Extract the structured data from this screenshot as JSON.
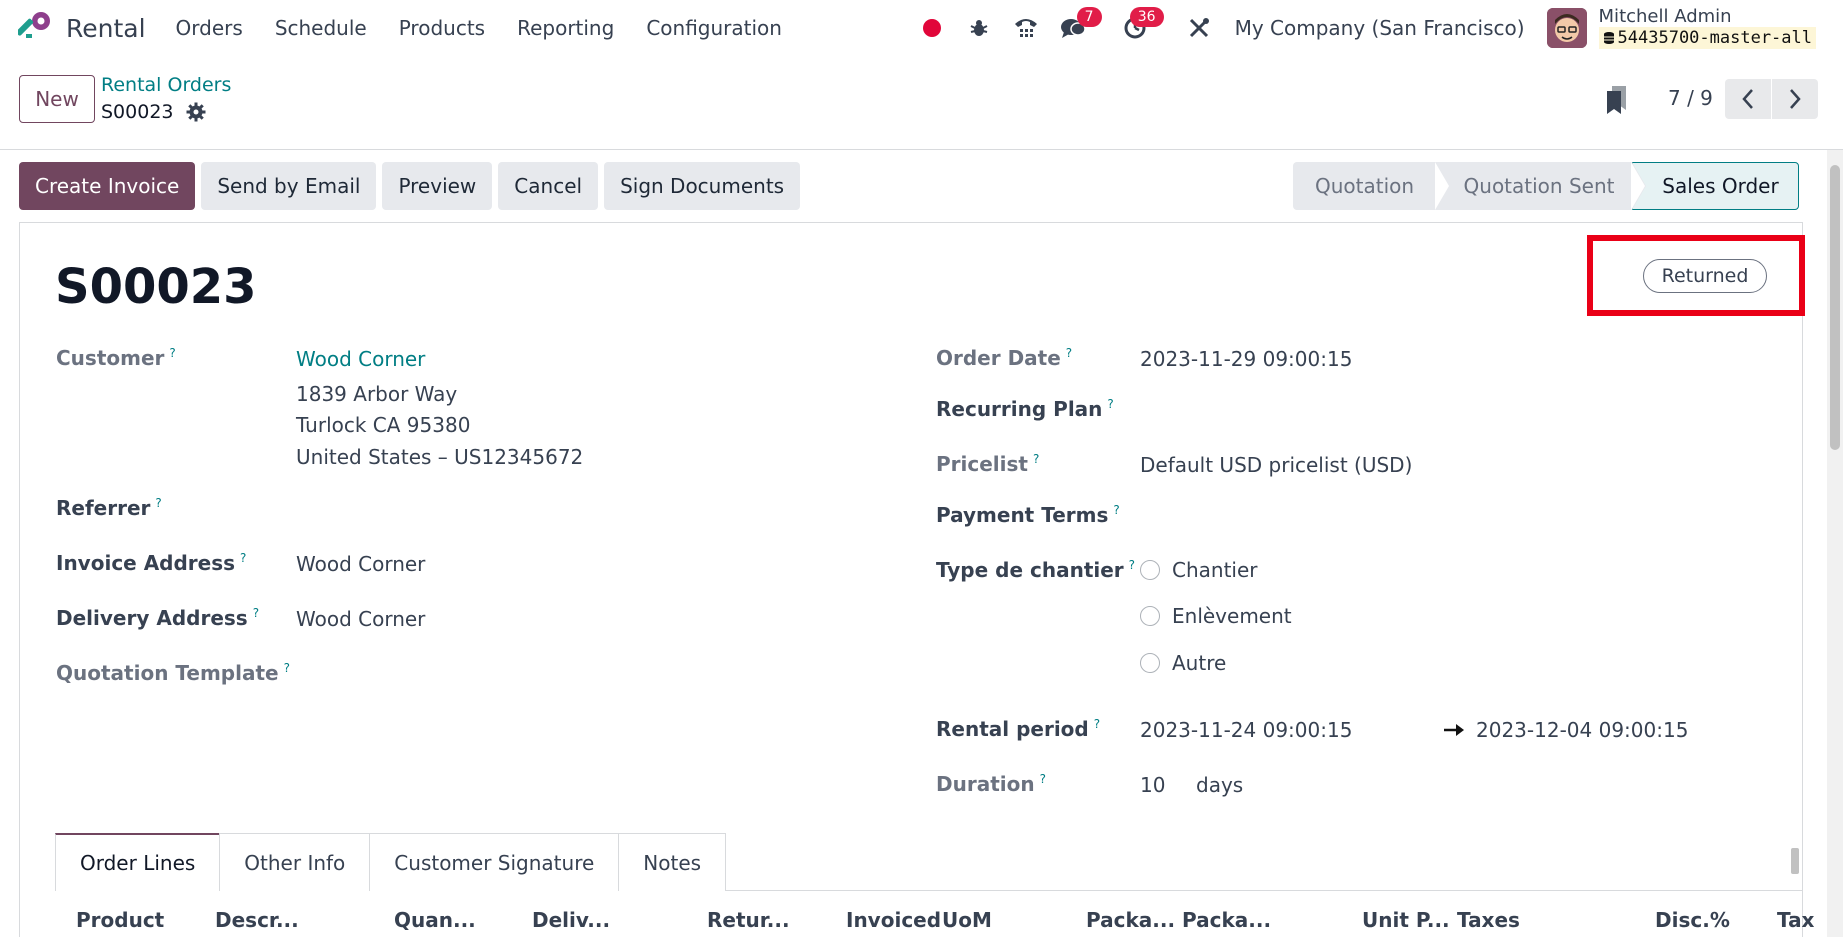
{
  "app": {
    "name": "Rental"
  },
  "menu": [
    "Orders",
    "Schedule",
    "Products",
    "Reporting",
    "Configuration"
  ],
  "systray": {
    "messages_count": "7",
    "activities_count": "36"
  },
  "company": "My Company (San Francisco)",
  "user": {
    "name": "Mitchell Admin",
    "database": "54435700-master-all"
  },
  "control": {
    "new_label": "New",
    "breadcrumb": "Rental Orders",
    "record": "S00023",
    "pager": "7 / 9"
  },
  "actions": {
    "create_invoice": "Create Invoice",
    "send_email": "Send by Email",
    "preview": "Preview",
    "cancel": "Cancel",
    "sign_documents": "Sign Documents"
  },
  "stages": [
    "Quotation",
    "Quotation Sent",
    "Sales Order"
  ],
  "ribbon": "Returned",
  "form": {
    "title": "S00023",
    "customer_label": "Customer",
    "customer_name": "Wood Corner",
    "customer_addr1": "1839 Arbor Way",
    "customer_addr2": "Turlock CA 95380",
    "customer_addr3": "United States – US12345672",
    "referrer_label": "Referrer",
    "invoice_addr_label": "Invoice Address",
    "invoice_addr_value": "Wood Corner",
    "delivery_addr_label": "Delivery Address",
    "delivery_addr_value": "Wood Corner",
    "quotation_template_label": "Quotation Template",
    "order_date_label": "Order Date",
    "order_date_value": "2023-11-29 09:00:15",
    "recurring_plan_label": "Recurring Plan",
    "pricelist_label": "Pricelist",
    "pricelist_value": "Default USD pricelist (USD)",
    "payment_terms_label": "Payment Terms",
    "chantier_label": "Type de chantier",
    "chantier_options": [
      "Chantier",
      "Enlèvement",
      "Autre"
    ],
    "rental_period_label": "Rental period",
    "rental_start": "2023-11-24 09:00:15",
    "rental_end": "2023-12-04 09:00:15",
    "duration_label": "Duration",
    "duration_value": "10",
    "duration_unit": "days",
    "help_mark": "?"
  },
  "tabs": [
    "Order Lines",
    "Other Info",
    "Customer Signature",
    "Notes"
  ],
  "columns": [
    "Product",
    "Descr...",
    "Quan...",
    "Deliv...",
    "Retur...",
    "Invoiced",
    "UoM",
    "Packa...",
    "Packa...",
    "Unit P...",
    "Taxes",
    "Disc.%",
    "Tax"
  ]
}
